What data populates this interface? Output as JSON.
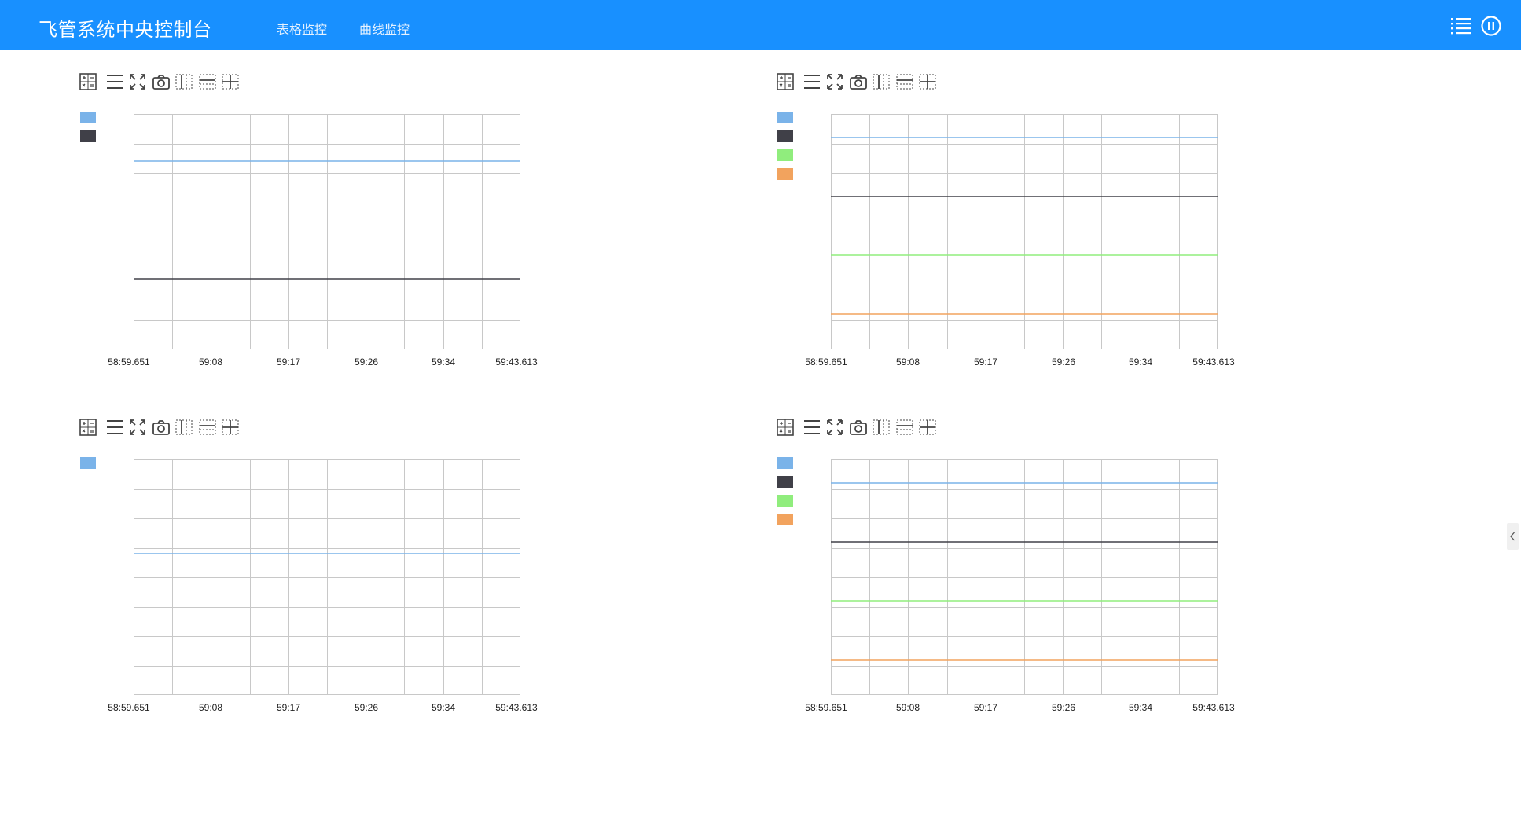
{
  "header": {
    "title": "飞管系统中央控制台",
    "nav": [
      "表格监控",
      "曲线监控"
    ],
    "right_icons": [
      "list-icon",
      "pause-circle-icon"
    ]
  },
  "toolbar_icons": [
    "calculator-icon",
    "menu-icon",
    "fullscreen-icon",
    "camera-icon",
    "vertical-cursor-icon",
    "horizontal-cursor-icon",
    "crosshair-cursor-icon"
  ],
  "colors": {
    "header_bg": "#1890ff",
    "series_blue": "#7ab3e9",
    "series_dark": "#404048",
    "series_green": "#90ed7d",
    "series_orange": "#f2a35e",
    "grid": "#c8c8c8"
  },
  "chart_data": [
    {
      "type": "line",
      "x_tick_labels": [
        "58:59.651",
        "59:08",
        "59:17",
        "59:26",
        "59:34",
        "59:43.613"
      ],
      "grid": true,
      "legend": "left",
      "series": [
        {
          "color": "#7ab3e9",
          "values": [
            0.8,
            0.8
          ]
        },
        {
          "color": "#404048",
          "values": [
            0.3,
            0.3
          ]
        }
      ],
      "ylim": [
        0,
        1
      ]
    },
    {
      "type": "line",
      "x_tick_labels": [
        "58:59.651",
        "59:08",
        "59:17",
        "59:26",
        "59:34",
        "59:43.613"
      ],
      "grid": true,
      "legend": "left",
      "series": [
        {
          "color": "#7ab3e9",
          "values": [
            0.9,
            0.9
          ]
        },
        {
          "color": "#404048",
          "values": [
            0.65,
            0.65
          ]
        },
        {
          "color": "#90ed7d",
          "values": [
            0.4,
            0.4
          ]
        },
        {
          "color": "#f2a35e",
          "values": [
            0.15,
            0.15
          ]
        }
      ],
      "ylim": [
        0,
        1
      ]
    },
    {
      "type": "line",
      "x_tick_labels": [
        "58:59.651",
        "59:08",
        "59:17",
        "59:26",
        "59:34",
        "59:43.613"
      ],
      "grid": true,
      "legend": "left",
      "series": [
        {
          "color": "#7ab3e9",
          "values": [
            0.6,
            0.6
          ]
        }
      ],
      "ylim": [
        0,
        1
      ]
    },
    {
      "type": "line",
      "x_tick_labels": [
        "58:59.651",
        "59:08",
        "59:17",
        "59:26",
        "59:34",
        "59:43.613"
      ],
      "grid": true,
      "legend": "left",
      "series": [
        {
          "color": "#7ab3e9",
          "values": [
            0.9,
            0.9
          ]
        },
        {
          "color": "#404048",
          "values": [
            0.65,
            0.65
          ]
        },
        {
          "color": "#90ed7d",
          "values": [
            0.4,
            0.4
          ]
        },
        {
          "color": "#f2a35e",
          "values": [
            0.15,
            0.15
          ]
        }
      ],
      "ylim": [
        0,
        1
      ]
    }
  ]
}
